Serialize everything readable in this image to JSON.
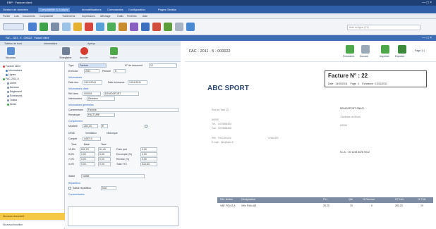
{
  "window": {
    "title": "EBP · Facture client",
    "controls": "— □ ×"
  },
  "menu": {
    "items": [
      {
        "label": "Gestion de données",
        "active": false
      },
      {
        "label": "Comptabilité & Analyse",
        "active": true
      },
      {
        "label": "Immobilisations",
        "active": false
      },
      {
        "label": "Commandes",
        "active": false
      },
      {
        "label": "Configuration",
        "active": false
      },
      {
        "label": "Pages Gestion",
        "active": false
      }
    ]
  },
  "submenu": {
    "items": [
      "Fichier",
      "Lots",
      "Documents",
      "Comptabilité",
      "Traitements",
      "Impressions",
      "Affichage",
      "Outils",
      "Fenêtres",
      "Aide"
    ]
  },
  "toolbar": {
    "search_placeholder": "Aide en ligne (F1)"
  },
  "doc_window": {
    "title": "FAC - 2011 - 5 - 000022 · Facture client",
    "controls": "— □ ×"
  },
  "left": {
    "tabs": [
      "Tableau de bord",
      "Informations",
      "Aperçu"
    ],
    "actions": [
      {
        "label": "Nouveau"
      },
      {
        "label": "Enregistrer"
      },
      {
        "label": "Annuler"
      },
      {
        "label": "Valider"
      }
    ],
    "tree": [
      "Facture client",
      "Informations",
      "Lignes",
      "FAC-2011-5",
      "Client",
      "Adresse",
      "Règlement",
      "Échéances",
      "Totaux",
      "Notes"
    ],
    "tree_footer_active": "Nouveau document",
    "tree_footer": "Nouveau brouillon"
  },
  "form": {
    "type_label": "Type",
    "type_value": "Facture",
    "num_label": "N° de document",
    "num_value": "22",
    "exercice_label": "Exercice",
    "exercice_value": "2011",
    "period_label": "Période",
    "period_value": "5",
    "sec_info": "Informations",
    "date_label": "Date doc.",
    "date_value": "13/10/2011",
    "echeance_label": "Date échéance",
    "echeance_value": "13/11/2011",
    "sec_client": "Informations client",
    "client_label": "Réf. tiers",
    "client_value": "000001",
    "client_name": "DEMOSPORT",
    "contact_label": "Interlocuteur",
    "contact_value": "Directeur",
    "sec_comment": "Informations générales",
    "commentaire_label": "Commentaire",
    "commentaire_value": "Facture",
    "remarque_label": "Remarque",
    "remarque_value": "FACTURE",
    "sec_compl": "Complément",
    "montant_label": "Montant",
    "montant_value": "262,23",
    "devise_value": "€",
    "subtabs": [
      "Détail",
      "Ventilation",
      "Historique"
    ],
    "tva_label": "Compte",
    "tva_value": "445710",
    "grid_head": [
      "Taux",
      "Base",
      "Taxe"
    ],
    "grid_rows": [
      [
        "19,6%",
        "262,23",
        "51,40"
      ],
      [
        "5,5%",
        "0,00",
        "0,00"
      ],
      [
        "7,0%",
        "0,00",
        "0,00"
      ],
      [
        "0,0%",
        "0,00",
        "0,00"
      ]
    ],
    "right_labels": [
      "Frais port",
      "Escompte (%)",
      "Remise (%)",
      "Total TTC"
    ],
    "right_values": [
      "0,00",
      "0,00",
      "0,00",
      "313,63"
    ],
    "statut_label": "Statut",
    "statut_value": "Validé",
    "sec_repart": "Répartition",
    "repart_check_label": "Saisie répartition",
    "repart_value": "Non",
    "sec_notes": "Commentaires"
  },
  "viewer": {
    "doc_title": "FAC - 2011 - 5 - 000022",
    "buttons": [
      "Précédent",
      "Suivant",
      "Imprimer",
      "Exporter"
    ],
    "page_label": "Page 1/1",
    "company": "ABC SPORT",
    "invoice_title": "Facture N° : 22",
    "invoice_date_label": "Date :",
    "invoice_date": "13/10/2011",
    "invoice_page": "Page : 1",
    "invoice_ref_label": "Échéance :",
    "invoice_ref": "13/11/2011",
    "sender_lines": [
      "Rue du Tarn 23",
      "",
      "69000",
      "Tél. : 0470556404",
      "Fax : 0470556405",
      "",
      "Réf. : FAC/2011/5",
      "",
      "E-mail : info@abc.fr"
    ],
    "sender_extra": "CHAUSS",
    "recipient_lines": [
      "DEMOSPORT SNAF+",
      "",
      "3 Avenue de Mons",
      "",
      "69006"
    ],
    "tva_line": "N.I.A. : 00 1234 5678 9012",
    "table_head": [
      "Réf. Article",
      "Désignation",
      "P.U.",
      "Qté",
      "% Remise",
      "HT Net",
      "% TVA"
    ],
    "table_row": [
      "VAE FOLIO-A",
      "Vélo Folio-A5",
      "26,23",
      "10",
      "0",
      "262,23",
      "19"
    ]
  }
}
